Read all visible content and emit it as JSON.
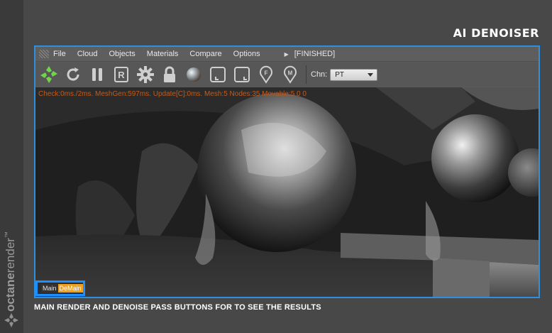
{
  "page": {
    "title": "AI DENOISER"
  },
  "brand": {
    "name": "octanerender",
    "trademark": "™"
  },
  "menubar": {
    "items": [
      "File",
      "Cloud",
      "Objects",
      "Materials",
      "Compare",
      "Options"
    ],
    "status": "[FINISHED]"
  },
  "toolbar": {
    "icons": [
      "octane-logo-icon",
      "refresh-icon",
      "pause-icon",
      "region-r-icon",
      "gear-icon",
      "lock-icon",
      "material-ball-icon",
      "picker-focus-icon",
      "picker-region-icon",
      "focus-pin-f-icon",
      "material-pin-m-icon"
    ],
    "channel_label": "Chn:",
    "channel_value": "PT"
  },
  "viewport": {
    "stats": "Check:0ms./2ms. MeshGen:597ms. Update[C]:0ms. Mesh:5 Nodes:35 Movable:5  0 0",
    "pass_main": "Main",
    "pass_denoise": "DeMain"
  },
  "caption": "MAIN RENDER AND DENOISE PASS BUTTONS FOR TO SEE THE RESULTS",
  "colors": {
    "accent": "#2d8fe0",
    "octane_green": "#6fd64a",
    "stats_orange": "#c45a1a",
    "denoise_orange": "#f0a020"
  }
}
